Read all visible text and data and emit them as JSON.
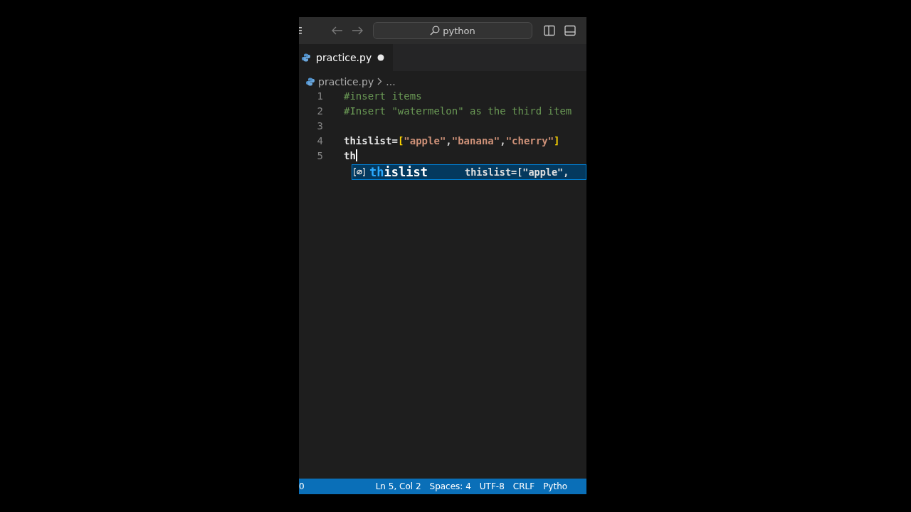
{
  "title_bar": {
    "search": "python"
  },
  "tab": {
    "label": "practice.py",
    "modified": true,
    "selected": true
  },
  "breadcrumb": {
    "file": "practice.py",
    "rest": "..."
  },
  "code_lines": [
    {
      "number": "1",
      "tokens": [
        {
          "text": "#insert items",
          "kind": "comment"
        }
      ]
    },
    {
      "number": "2",
      "tokens": [
        {
          "text": "#Insert \"watermelon\" as the third item",
          "kind": "comment"
        }
      ]
    },
    {
      "number": "3"
    },
    {
      "number": "4",
      "tokens": [
        {
          "text": "thislist",
          "kind": "ident"
        },
        {
          "text": "=",
          "kind": "punct"
        },
        {
          "text": "[",
          "kind": "bracket"
        },
        {
          "text": "\"apple\"",
          "kind": "string"
        },
        {
          "text": ",",
          "kind": "punct"
        },
        {
          "text": "\"banana\"",
          "kind": "string"
        },
        {
          "text": ",",
          "kind": "punct"
        },
        {
          "text": "\"cherry\"",
          "kind": "string"
        },
        {
          "text": "]",
          "kind": "bracket"
        }
      ]
    },
    {
      "number": "5",
      "tokens": [
        {
          "text": "th",
          "kind": "ident"
        }
      ],
      "cursor": true
    }
  ],
  "suggestion": {
    "match": "th",
    "rest": "islist",
    "detail": "thislist=[\"apple\",",
    "selected": true
  },
  "status_bar": [
    "0",
    "Ln 5, Col 2",
    "Spaces: 4",
    "UTF-8",
    "CRLF",
    "Pytho"
  ]
}
